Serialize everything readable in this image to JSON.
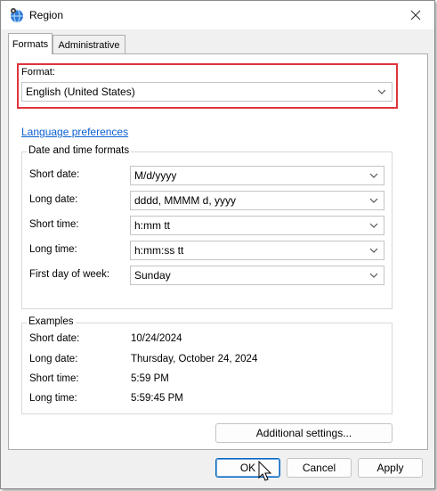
{
  "window": {
    "title": "Region"
  },
  "tabs": [
    {
      "label": "Formats",
      "active": true
    },
    {
      "label": "Administrative",
      "active": false
    }
  ],
  "format": {
    "label": "Format:",
    "value": "English (United States)"
  },
  "language_link": "Language preferences",
  "date_time_group": {
    "title": "Date and time formats",
    "rows": [
      {
        "label": "Short date:",
        "value": "M/d/yyyy"
      },
      {
        "label": "Long date:",
        "value": "dddd, MMMM d, yyyy"
      },
      {
        "label": "Short time:",
        "value": "h:mm tt"
      },
      {
        "label": "Long time:",
        "value": "h:mm:ss tt"
      },
      {
        "label": "First day of week:",
        "value": "Sunday"
      }
    ]
  },
  "examples_group": {
    "title": "Examples",
    "rows": [
      {
        "label": "Short date:",
        "value": "10/24/2024"
      },
      {
        "label": "Long date:",
        "value": "Thursday, October 24, 2024"
      },
      {
        "label": "Short time:",
        "value": "5:59 PM"
      },
      {
        "label": "Long time:",
        "value": "5:59:45 PM"
      }
    ]
  },
  "buttons": {
    "additional_settings": "Additional settings...",
    "ok": "OK",
    "cancel": "Cancel",
    "apply": "Apply"
  },
  "colors": {
    "highlight_border": "#e0343a",
    "link": "#0b5fd1",
    "default_button_border": "#0067c0"
  }
}
